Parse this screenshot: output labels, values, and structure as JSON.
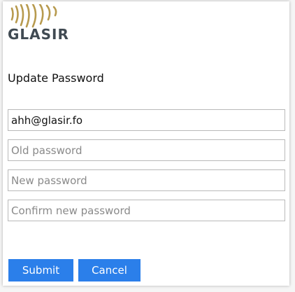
{
  "brand": {
    "name": "GLASIR",
    "mark_icon": "glasir-arcs-logo",
    "mark_color": "#b79a4e",
    "text_color": "#404a52"
  },
  "form": {
    "title": "Update Password",
    "email_value": "ahh@glasir.fo",
    "old_password_placeholder": "Old password",
    "new_password_placeholder": "New password",
    "confirm_password_placeholder": "Confirm new password"
  },
  "actions": {
    "submit_label": "Submit",
    "cancel_label": "Cancel",
    "button_color": "#2b7fea"
  }
}
